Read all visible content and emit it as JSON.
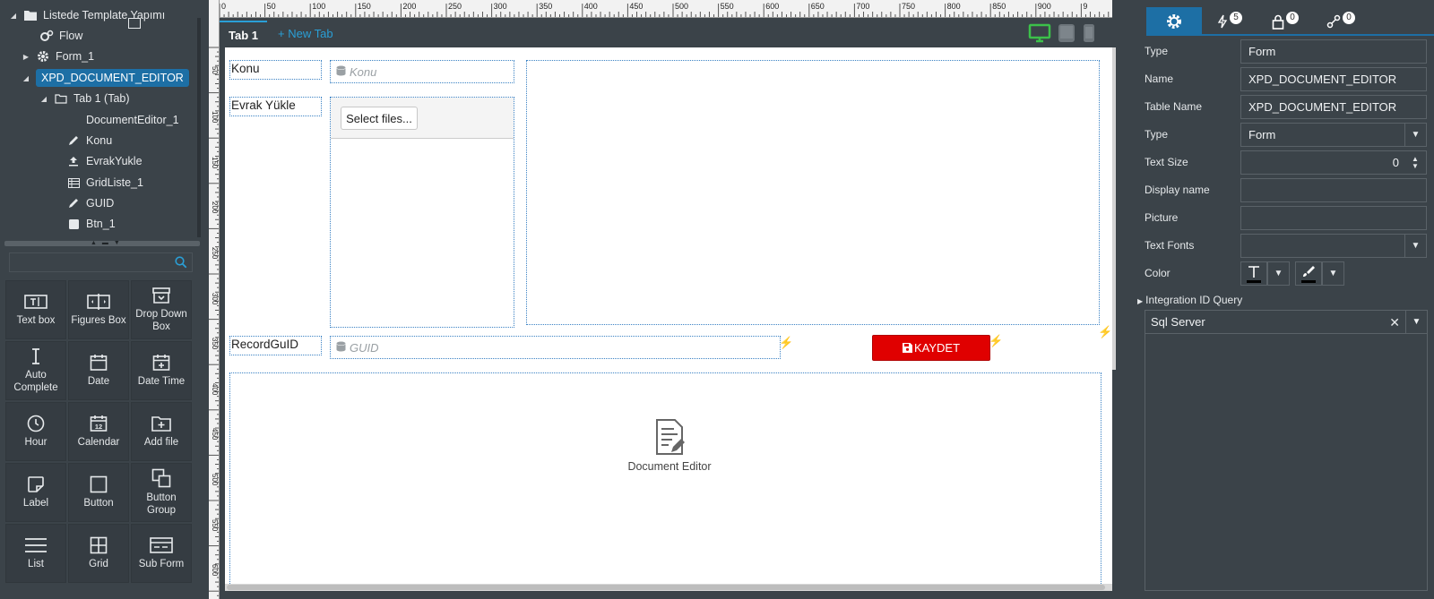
{
  "tree": {
    "root": "Listede Template Yapımı",
    "items": [
      {
        "label": "Flow"
      },
      {
        "label": "Form_1"
      },
      {
        "label": "XPD_DOCUMENT_EDITOR"
      },
      {
        "label": "Tab 1 (Tab)"
      },
      {
        "label": "DocumentEditor_1"
      },
      {
        "label": "Konu"
      },
      {
        "label": "EvrakYukle"
      },
      {
        "label": "GridListe_1"
      },
      {
        "label": "GUID"
      },
      {
        "label": "Btn_1"
      }
    ]
  },
  "toolbox": {
    "search_placeholder": "",
    "tools": [
      {
        "label": "Text box",
        "icon": "textbox-icon"
      },
      {
        "label": "Figures Box",
        "icon": "figures-box-icon"
      },
      {
        "label": "Drop Down Box",
        "icon": "dropdown-box-icon"
      },
      {
        "label": "Auto Complete",
        "icon": "autocomplete-icon"
      },
      {
        "label": "Date",
        "icon": "date-icon"
      },
      {
        "label": "Date Time",
        "icon": "datetime-icon"
      },
      {
        "label": "Hour",
        "icon": "clock-icon"
      },
      {
        "label": "Calendar",
        "icon": "calendar-icon"
      },
      {
        "label": "Add file",
        "icon": "add-file-icon"
      },
      {
        "label": "Label",
        "icon": "label-icon"
      },
      {
        "label": "Button",
        "icon": "button-icon"
      },
      {
        "label": "Button Group",
        "icon": "button-group-icon"
      },
      {
        "label": "List",
        "icon": "list-icon"
      },
      {
        "label": "Grid",
        "icon": "grid-icon"
      },
      {
        "label": "Sub Form",
        "icon": "subform-icon"
      }
    ]
  },
  "ruler": {
    "h_marks": [
      "0",
      "50",
      "100",
      "150",
      "200",
      "250",
      "300",
      "350",
      "400",
      "450",
      "500",
      "550",
      "600",
      "650",
      "700",
      "750",
      "800",
      "850",
      "900",
      "9"
    ],
    "v_marks": [
      "50",
      "100",
      "150",
      "200",
      "250",
      "300",
      "350",
      "400",
      "450",
      "500",
      "550",
      "600"
    ]
  },
  "tabs": {
    "active": "Tab 1",
    "new_tab": "+ New Tab"
  },
  "form": {
    "konu_label": "Konu",
    "konu_placeholder": "Konu",
    "evrak_label": "Evrak Yükle",
    "select_files": "Select files...",
    "guid_label": "RecordGuID",
    "guid_placeholder": "GUID",
    "save_button": "KAYDET",
    "doc_editor_label": "Document Editor"
  },
  "props": {
    "tabs": [
      {
        "icon": "gear-icon",
        "badge": ""
      },
      {
        "icon": "bolt-icon",
        "badge": "5"
      },
      {
        "icon": "lock-icon",
        "badge": "0"
      },
      {
        "icon": "link-icon",
        "badge": "0"
      }
    ],
    "type_label": "Type",
    "type_value": "Form",
    "name_label": "Name",
    "name_value": "XPD_DOCUMENT_EDITOR",
    "table_name_label": "Table Name",
    "table_name_value": "XPD_DOCUMENT_EDITOR",
    "type2_label": "Type",
    "type2_value": "Form",
    "text_size_label": "Text Size",
    "text_size_value": "0",
    "display_name_label": "Display name",
    "display_name_value": "",
    "picture_label": "Picture",
    "picture_value": "",
    "text_fonts_label": "Text Fonts",
    "text_fonts_value": "",
    "color_label": "Color",
    "integration_label": "Integration ID Query",
    "integration_value": "Sql Server"
  },
  "colors": {
    "accent": "#1d6fa5",
    "save_red": "#e00000",
    "panel_bg": "#3b4349"
  }
}
